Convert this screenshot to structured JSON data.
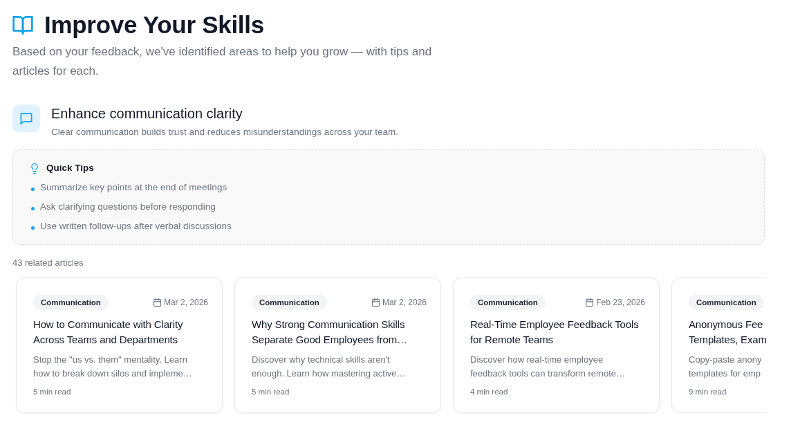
{
  "header": {
    "title": "Improve Your Skills",
    "subtitle": "Based on your feedback, we've identified areas to help you grow — with tips and articles for each."
  },
  "skill": {
    "title": "Enhance communication clarity",
    "description": "Clear communication builds trust and reduces misunderstandings across your team.",
    "quick_tips": {
      "heading": "Quick Tips",
      "tips": [
        "Summarize key points at the end of meetings",
        "Ask clarifying questions before responding",
        "Use written follow-ups after verbal discussions"
      ]
    },
    "articles_count": "43 related articles",
    "articles": [
      {
        "category": "Communication",
        "date": "Mar 2, 2026",
        "title": "How to Communicate with Clarity\nAcross Teams and Departments",
        "summary": "Stop the \"us vs. them\" mentality. Learn\nhow to break down silos and impleme…",
        "read_time": "5 min read",
        "cut": false
      },
      {
        "category": "Communication",
        "date": "Mar 2, 2026",
        "title": "Why Strong Communication Skills\nSeparate Good Employees from…",
        "summary": "Discover why technical skills aren't\nenough. Learn how mastering active…",
        "read_time": "5 min read",
        "cut": false
      },
      {
        "category": "Communication",
        "date": "Feb 23, 2026",
        "title": "Real-Time Employee Feedback Tools\nfor Remote Teams",
        "summary": "Discover how real-time employee\nfeedback tools can transform remote…",
        "read_time": "4 min read",
        "cut": false
      },
      {
        "category": "Communication",
        "title": "Anonymous Fee\nTemplates, Exam",
        "summary": "Copy-paste anony\ntemplates for emp",
        "read_time": "9 min read",
        "cut": true
      }
    ]
  }
}
